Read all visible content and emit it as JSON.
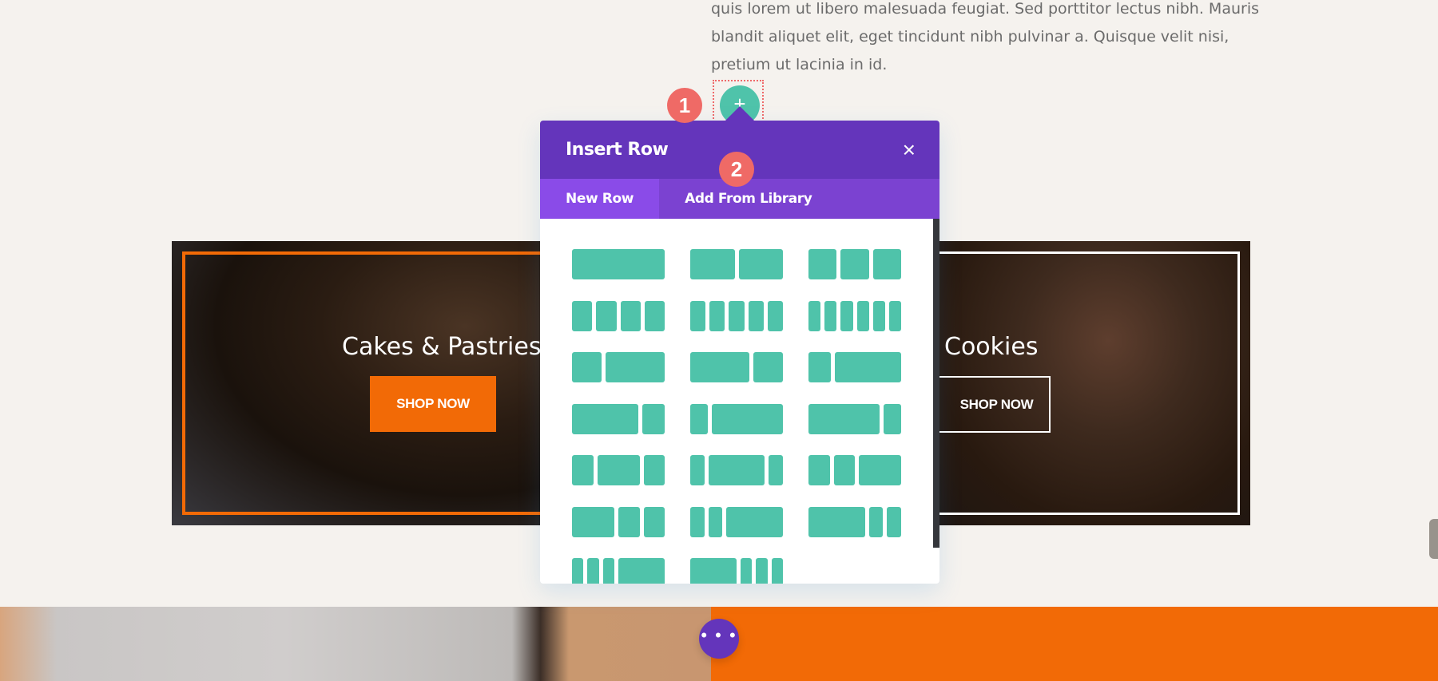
{
  "body_text": {
    "lines": [
      "quis lorem ut libero malesuada feugiat. Sed porttitor lectus nibh. Mauris",
      "blandit aliquet elit, eget tincidunt nibh pulvinar a. Quisque velit nisi,",
      "pretium ut lacinia in id."
    ]
  },
  "cards": [
    {
      "title": "Cakes & Pastries",
      "button": "SHOP NOW"
    },
    {
      "title": "Cookies",
      "button": "SHOP NOW"
    }
  ],
  "add_row_button": {
    "icon": "plus-icon",
    "label": "+"
  },
  "badges": {
    "step1": "1",
    "step2": "2"
  },
  "modal": {
    "title": "Insert Row",
    "close_icon": "×",
    "tabs": [
      {
        "label": "New Row",
        "active": true
      },
      {
        "label": "Add From Library",
        "active": false
      }
    ],
    "layouts": [
      [
        1
      ],
      [
        1,
        1
      ],
      [
        1,
        1,
        1
      ],
      [
        1,
        1,
        1,
        1
      ],
      [
        1,
        1,
        1,
        1,
        1
      ],
      [
        1,
        1,
        1,
        1,
        1,
        1
      ],
      [
        1,
        2
      ],
      [
        2,
        1
      ],
      [
        1,
        3
      ],
      [
        3,
        1
      ],
      [
        1,
        4
      ],
      [
        4,
        1
      ],
      [
        1,
        2,
        1
      ],
      [
        1,
        4,
        1
      ],
      [
        1,
        1,
        2
      ],
      [
        2,
        1,
        1
      ],
      [
        1,
        1,
        4
      ],
      [
        4,
        1,
        1
      ],
      [
        1,
        1,
        1,
        4
      ],
      [
        4,
        1,
        1,
        1
      ]
    ]
  },
  "floating_menu": {
    "icon": "more-dots-icon",
    "label": "• • •"
  },
  "colors": {
    "purple": "#6435bb",
    "tab_active": "#8a4be8",
    "teal": "#4fc3aa",
    "orange": "#f26a06",
    "badge": "#ef6a66"
  }
}
